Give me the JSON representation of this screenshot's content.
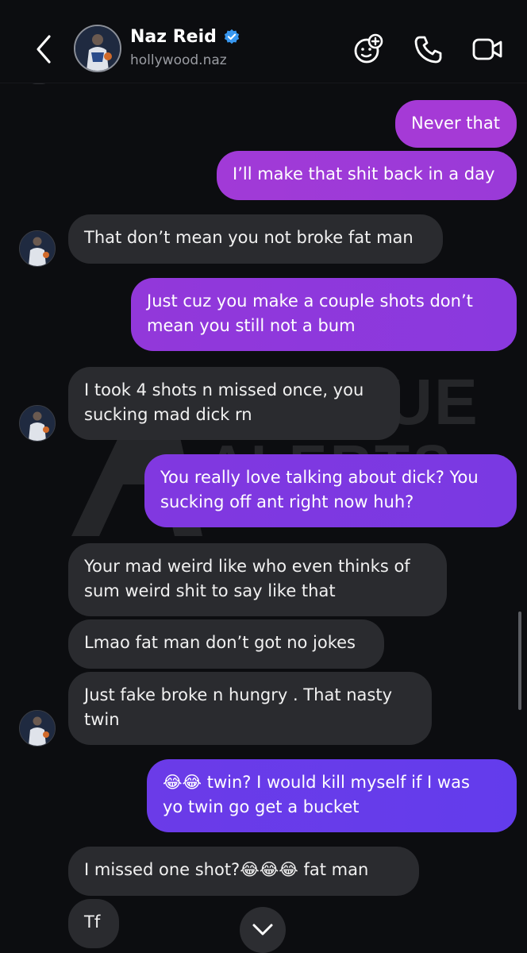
{
  "header": {
    "contact_name": "Naz Reid",
    "handle": "hollywood.naz",
    "icons": [
      "back-chevron-icon",
      "verified-badge-icon",
      "add-effect-icon",
      "phone-icon",
      "video-camera-icon"
    ]
  },
  "watermark": {
    "line1": "LEAGUE",
    "line2": "ALERTS"
  },
  "messages": [
    {
      "from": "me",
      "text": "Never that"
    },
    {
      "from": "me",
      "text": "I’ll make that shit back in a day"
    },
    {
      "from": "them",
      "text": "That don’t mean you not broke fat man"
    },
    {
      "from": "me",
      "line1": "Just cuz you make a couple shots don’t",
      "line2": "mean you still not a bum"
    },
    {
      "from": "them",
      "line1": "I took 4 shots n missed once, you",
      "line2": "sucking mad dick rn"
    },
    {
      "from": "me",
      "line1": "You really love talking about dick? You",
      "line2": "sucking off ant right now huh?"
    },
    {
      "from": "them",
      "line1": "Your mad weird like who even thinks of",
      "line2": "sum weird shit to say like that"
    },
    {
      "from": "them",
      "text": "Lmao fat man don’t got no jokes"
    },
    {
      "from": "them",
      "line1": "Just fake broke n hungry . That nasty",
      "line2": "twin"
    },
    {
      "from": "me",
      "line1": "😂😂 twin? I would kill myself if I was",
      "line2": "yo twin go get a bucket"
    },
    {
      "from": "them",
      "text": "I missed one shot?😂😂😂 fat man"
    },
    {
      "from": "them",
      "text": "Tf"
    }
  ],
  "colors": {
    "background": "#0c0d10",
    "incoming_bubble": "#2a2b2f",
    "outgoing_gradient": [
      "#a53ad6",
      "#6a3bea"
    ],
    "verified": "#3897f0"
  }
}
